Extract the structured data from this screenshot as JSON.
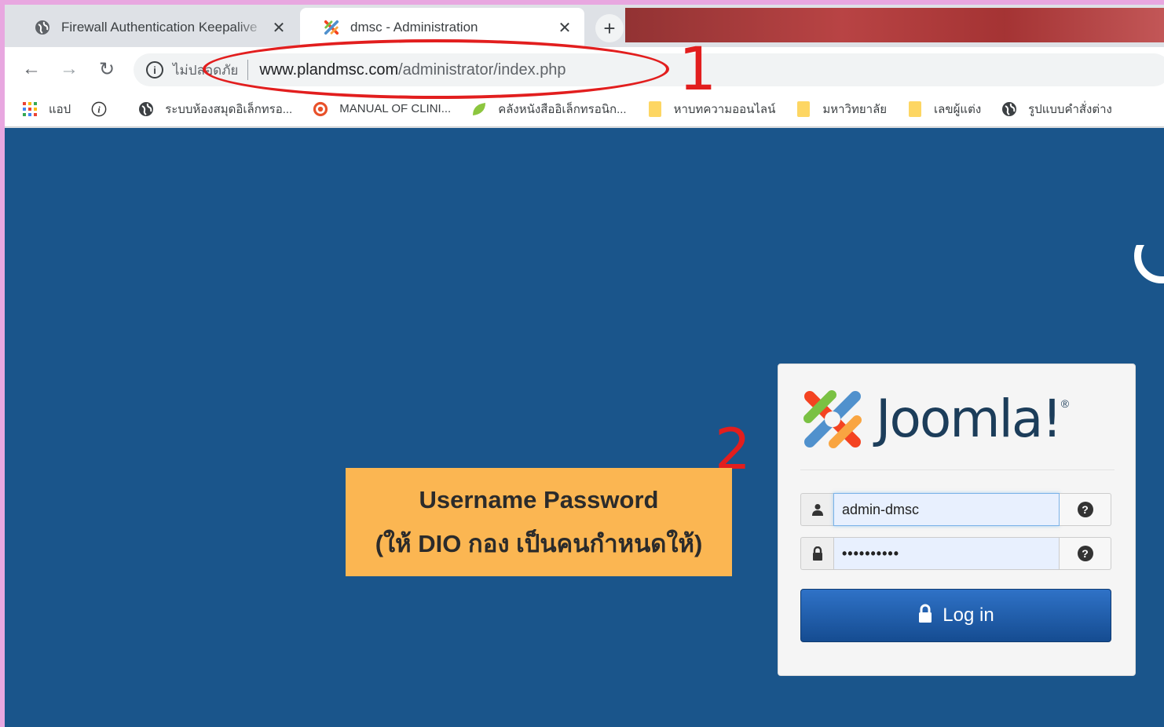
{
  "tabs": [
    {
      "title": "Firewall Authentication Keepalive",
      "active": false,
      "icon": "globe-icon"
    },
    {
      "title": "dmsc - Administration",
      "active": true,
      "icon": "joomla-icon"
    }
  ],
  "toolbar": {
    "security_label": "ไม่ปลอดภัย",
    "url_host": "www.plandmsc.com",
    "url_path": "/administrator/index.php"
  },
  "bookmarks": [
    {
      "label": "แอป",
      "icon": "apps-grid-icon"
    },
    {
      "label": "",
      "icon": "info-circle-icon"
    },
    {
      "label": "ระบบห้องสมุดอิเล็กทรอ...",
      "icon": "globe-icon"
    },
    {
      "label": "MANUAL OF CLINI...",
      "icon": "target-icon"
    },
    {
      "label": "คลังหนังสืออิเล็กทรอนิก...",
      "icon": "leaf-icon"
    },
    {
      "label": "หาบทความออนไลน์",
      "icon": "folder-icon"
    },
    {
      "label": "มหาวิทยาลัย",
      "icon": "folder-icon"
    },
    {
      "label": "เลขผู้แต่ง",
      "icon": "folder-icon"
    },
    {
      "label": "รูปแบบคำสั่งต่าง",
      "icon": "globe-icon"
    }
  ],
  "login": {
    "brand": "Joomla!",
    "username_value": "admin-dmsc",
    "password_mask": "••••••••••",
    "button_label": "Log in"
  },
  "annotations": {
    "step1": "1",
    "step2": "2",
    "note_line1": "Username Password",
    "note_line2": "(ให้ DIO กอง เป็นคนกำหนดให้)"
  },
  "colors": {
    "page_background": "#1a558b",
    "annotation_red": "#e21e1e",
    "note_orange": "#fbb652",
    "login_button": "#1d5aa5"
  }
}
